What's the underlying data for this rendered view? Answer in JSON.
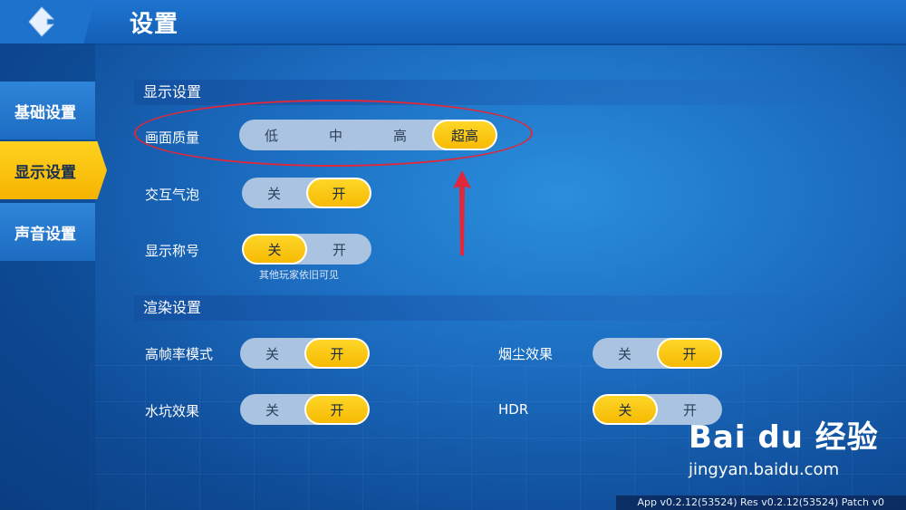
{
  "header": {
    "title": "设置"
  },
  "sidebar": {
    "items": [
      {
        "label": "基础设置",
        "active": false
      },
      {
        "label": "显示设置",
        "active": true
      },
      {
        "label": "声音设置",
        "active": false
      }
    ]
  },
  "display_section": {
    "title": "显示设置",
    "quality": {
      "label": "画面质量",
      "options": [
        "低",
        "中",
        "高",
        "超高"
      ],
      "selected": "超高"
    },
    "bubbles": {
      "label": "交互气泡",
      "off": "关",
      "on": "开",
      "selected": "开"
    },
    "titles": {
      "label": "显示称号",
      "off": "关",
      "on": "开",
      "selected": "关",
      "note": "其他玩家依旧可见"
    }
  },
  "render_section": {
    "title": "渲染设置",
    "high_fps": {
      "label": "高帧率模式",
      "off": "关",
      "on": "开",
      "selected": "开"
    },
    "dust": {
      "label": "烟尘效果",
      "off": "关",
      "on": "开",
      "selected": "开"
    },
    "water": {
      "label": "水坑效果",
      "off": "关",
      "on": "开",
      "selected": "开"
    },
    "hdr": {
      "label": "HDR",
      "off": "关",
      "on": "开",
      "selected": "关"
    }
  },
  "watermark": {
    "logo": "Bai du 经验",
    "url": "jingyan.baidu.com"
  },
  "footer": {
    "version": "App v0.2.12(53524)  Res v0.2.12(53524)  Patch v0"
  },
  "colors": {
    "accent": "#f6b800",
    "annotation": "#e0283a",
    "background": "#1b6bbf"
  }
}
